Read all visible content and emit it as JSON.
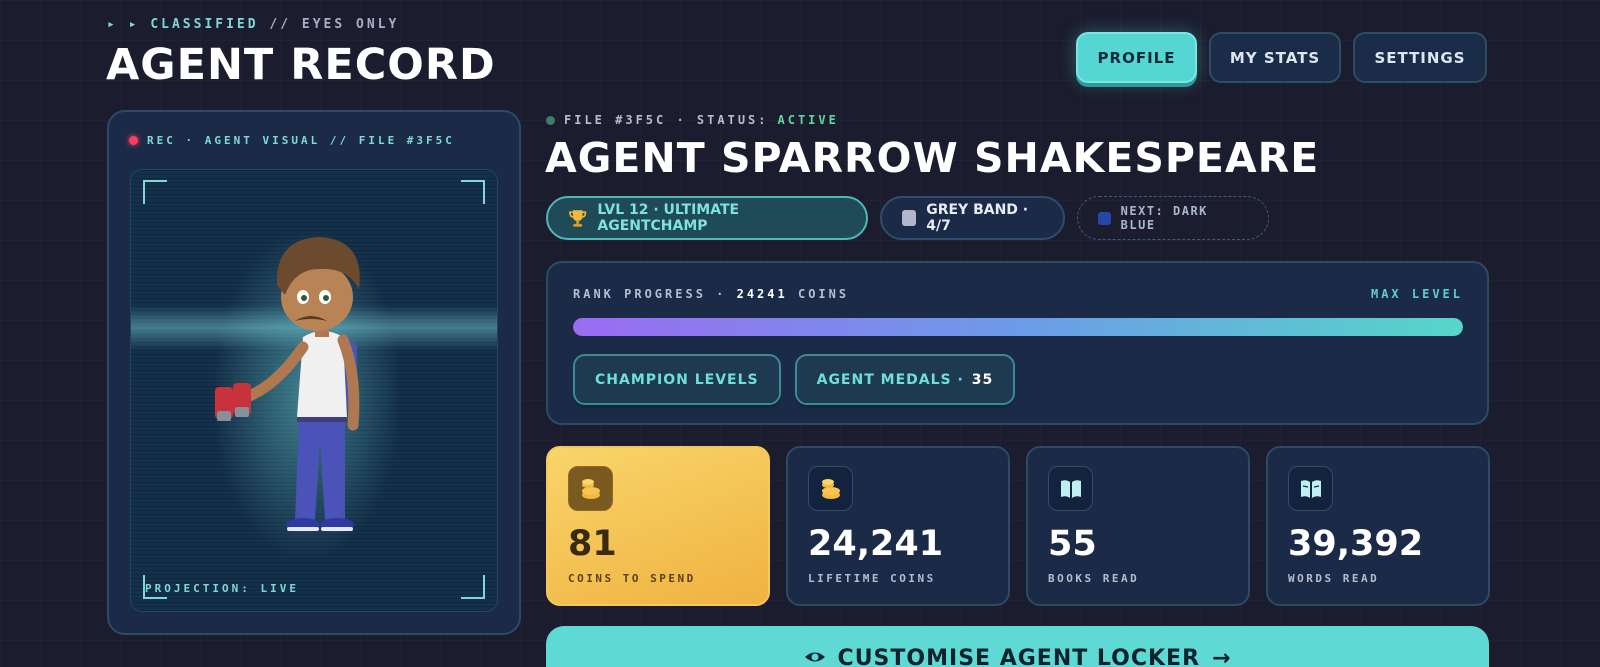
{
  "header": {
    "eyebrow_arrows": "▸ ▸",
    "eyebrow_classified": "CLASSIFIED",
    "eyebrow_rest": "// EYES ONLY",
    "title": "AGENT RECORD"
  },
  "tabs": [
    {
      "label": "PROFILE",
      "active": true
    },
    {
      "label": "MY STATS",
      "active": false
    },
    {
      "label": "SETTINGS",
      "active": false
    }
  ],
  "avatar": {
    "rec_label": "REC · AGENT VISUAL // FILE #3F5C",
    "projection": "PROJECTION: LIVE"
  },
  "file": {
    "prefix": "FILE #3F5C · STATUS:",
    "status": "ACTIVE"
  },
  "agent_name": "AGENT SPARROW SHAKESPEARE",
  "badges": {
    "level": "LVL 12 · ULTIMATE AGENTCHAMP",
    "level_icon": "trophy-icon",
    "band": "GREY BAND · 4/7",
    "band_color": "#b2b6cc",
    "next": "NEXT: DARK BLUE",
    "next_color": "#2747a8"
  },
  "rank": {
    "label": "RANK PROGRESS ·",
    "coins": "24241",
    "coins_suffix": "COINS",
    "max_level": "MAX LEVEL",
    "progress": 1.0,
    "champion_levels": "CHAMPION LEVELS",
    "agent_medals": "AGENT MEDALS ·",
    "medals_count": "35"
  },
  "stats": [
    {
      "value": "81",
      "label": "COINS TO SPEND",
      "icon": "coins-icon"
    },
    {
      "value": "24,241",
      "label": "LIFETIME COINS",
      "icon": "coins-icon"
    },
    {
      "value": "55",
      "label": "BOOKS READ",
      "icon": "book-icon"
    },
    {
      "value": "39,392",
      "label": "WORDS READ",
      "icon": "book-icon"
    }
  ],
  "cta": {
    "label": "CUSTOMISE AGENT LOCKER",
    "arrow": "→",
    "icon": "eye-icon"
  },
  "colors": {
    "accent": "#56d6d2",
    "gold": "#f5c453",
    "status_active": "#5fd6a0",
    "rec": "#ff3d5e"
  }
}
